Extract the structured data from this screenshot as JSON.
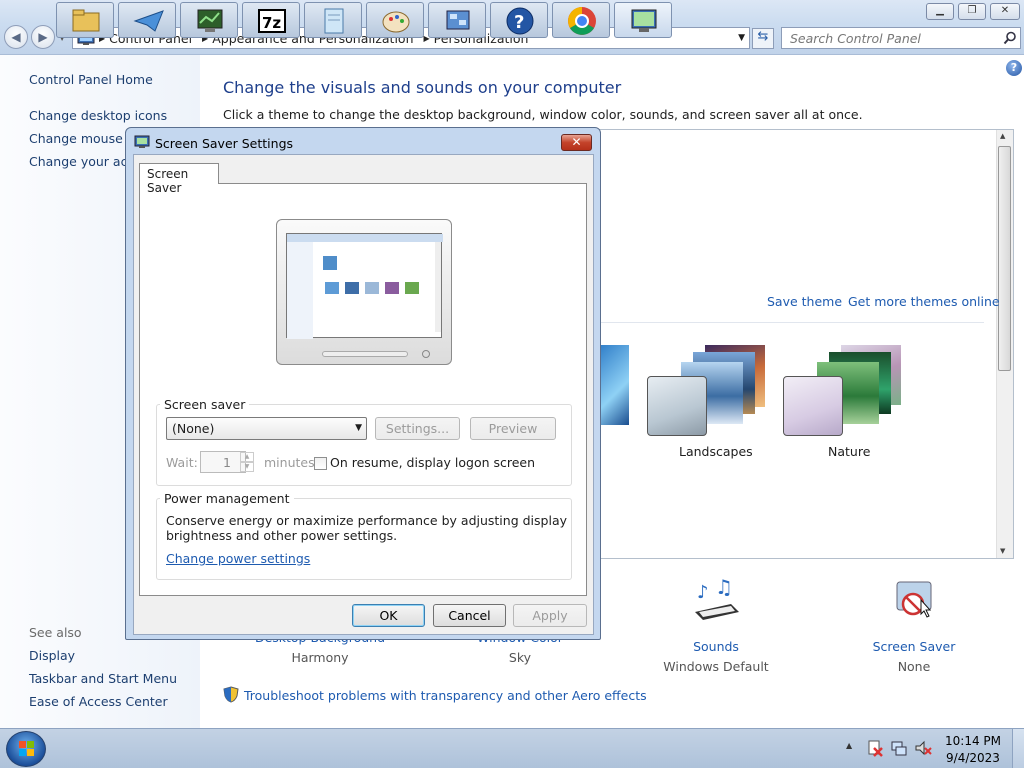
{
  "window": {
    "caption_buttons": [
      "minimize",
      "maximize",
      "close"
    ]
  },
  "address": {
    "breadcrumbs": [
      "Control Panel",
      "Appearance and Personalization",
      "Personalization"
    ],
    "search_placeholder": "Search Control Panel"
  },
  "left_pane": {
    "home": "Control Panel Home",
    "links": [
      "Change desktop icons",
      "Change mouse pointers",
      "Change your account picture"
    ],
    "see_also_heading": "See also",
    "see_also": [
      "Display",
      "Taskbar and Start Menu",
      "Ease of Access Center"
    ]
  },
  "main": {
    "title": "Change the visuals and sounds on your computer",
    "subtitle": "Click a theme to change the desktop background, window color, sounds, and screen saver all at once.",
    "save_theme": "Save theme",
    "get_more_themes": "Get more themes online",
    "themes": [
      {
        "name": "Landscapes"
      },
      {
        "name": "Nature"
      }
    ],
    "bottom_items": [
      {
        "label": "Desktop Background",
        "value": "Harmony"
      },
      {
        "label": "Window Color",
        "value": "Sky"
      },
      {
        "label": "Sounds",
        "value": "Windows Default"
      },
      {
        "label": "Screen Saver",
        "value": "None"
      }
    ],
    "troubleshoot": "Troubleshoot problems with transparency and other Aero effects"
  },
  "dialog": {
    "title": "Screen Saver Settings",
    "tab": "Screen Saver",
    "screen_saver_group": "Screen saver",
    "selected": "(None)",
    "settings_button": "Settings...",
    "preview_button": "Preview",
    "wait_label": "Wait:",
    "wait_value": "1",
    "minutes_label": "minutes",
    "resume_label": "On resume, display logon screen",
    "power_group": "Power management",
    "power_text_1": "Conserve energy or maximize performance by adjusting display",
    "power_text_2": "brightness and other power settings.",
    "power_link": "Change power settings",
    "ok": "OK",
    "cancel": "Cancel",
    "apply": "Apply"
  },
  "taskbar": {
    "apps": [
      "file-explorer",
      "mail",
      "control-panel",
      "7-zip",
      "notepad",
      "paint",
      "remote-desktop",
      "help",
      "chrome",
      "personalization"
    ],
    "time": "10:14 PM",
    "date": "9/4/2023"
  }
}
